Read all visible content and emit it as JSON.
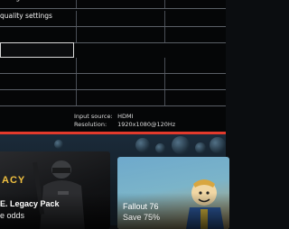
{
  "settings_menu": {
    "items": [
      {
        "label": "ettings"
      },
      {
        "label": "quality settings"
      },
      {
        "label": ""
      },
      {
        "label": ""
      },
      {
        "label": ""
      },
      {
        "label": ""
      },
      {
        "label": ""
      }
    ],
    "input_source_label": "Input source:",
    "input_source_value": "HDMI",
    "resolution_label": "Resolution:",
    "resolution_value": "1920x1080@120Hz",
    "accent_color": "#e23a2c"
  },
  "store": {
    "tiles": [
      {
        "title": "E. Legacy Pack",
        "subtitle": "e odds",
        "logo": "ACY"
      },
      {
        "title": "Fallout 76",
        "subtitle": "Save 75%"
      }
    ]
  }
}
